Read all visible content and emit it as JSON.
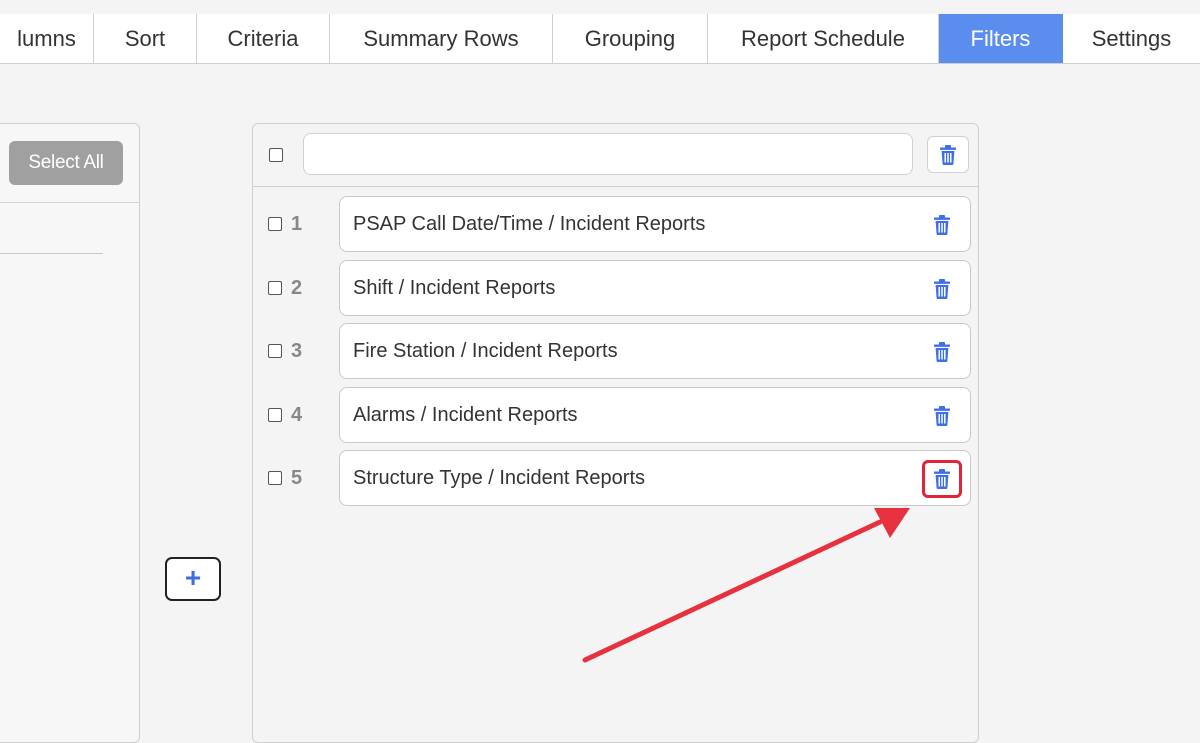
{
  "tabs": [
    {
      "label": "lumns",
      "active": false
    },
    {
      "label": "Sort",
      "active": false
    },
    {
      "label": "Criteria",
      "active": false
    },
    {
      "label": "Summary Rows",
      "active": false
    },
    {
      "label": "Grouping",
      "active": false
    },
    {
      "label": "Report Schedule",
      "active": false
    },
    {
      "label": "Filters",
      "active": true
    },
    {
      "label": "Settings",
      "active": false
    }
  ],
  "left_panel": {
    "select_all_label": "Select All"
  },
  "add_button": {
    "label": "+"
  },
  "filter_panel": {
    "header_input_value": "",
    "rows": [
      {
        "number": "1",
        "label": "PSAP Call Date/Time / Incident Reports"
      },
      {
        "number": "2",
        "label": "Shift / Incident Reports"
      },
      {
        "number": "3",
        "label": "Fire Station / Incident Reports"
      },
      {
        "number": "4",
        "label": "Alarms / Incident Reports"
      },
      {
        "number": "5",
        "label": "Structure Type / Incident Reports"
      }
    ]
  },
  "icons": {
    "trash": "trash-icon",
    "add": "plus-icon"
  },
  "colors": {
    "accent": "#5b8def",
    "trash_blue": "#3f6fe8",
    "highlight_red": "#e0243a",
    "button_gray": "#a0a0a0"
  }
}
